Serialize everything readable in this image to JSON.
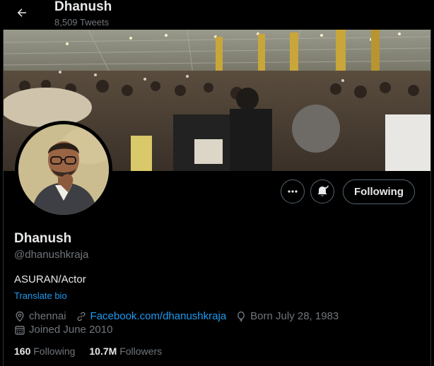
{
  "header": {
    "name": "Dhanush",
    "tweet_count": "8,509 Tweets"
  },
  "actions": {
    "following_label": "Following"
  },
  "profile": {
    "name": "Dhanush",
    "handle": "@dhanushkraja",
    "bio": "ASURAN/Actor",
    "translate_label": "Translate bio",
    "location": "chennai",
    "website": "Facebook.com/dhanushkraja",
    "birthday": "Born July 28, 1983",
    "joined": "Joined June 2010"
  },
  "stats": {
    "following_count": "160",
    "following_label": "Following",
    "followers_count": "10.7M",
    "followers_label": "Followers"
  },
  "colors": {
    "background": "#000000",
    "text_primary": "#e7e9ea",
    "text_secondary": "#71767b",
    "link": "#1d9bf0",
    "border": "#536471"
  },
  "icons": [
    "back-arrow-icon",
    "more-icon",
    "notification-bell-icon",
    "location-icon",
    "link-icon",
    "birthday-balloon-icon",
    "calendar-icon"
  ]
}
